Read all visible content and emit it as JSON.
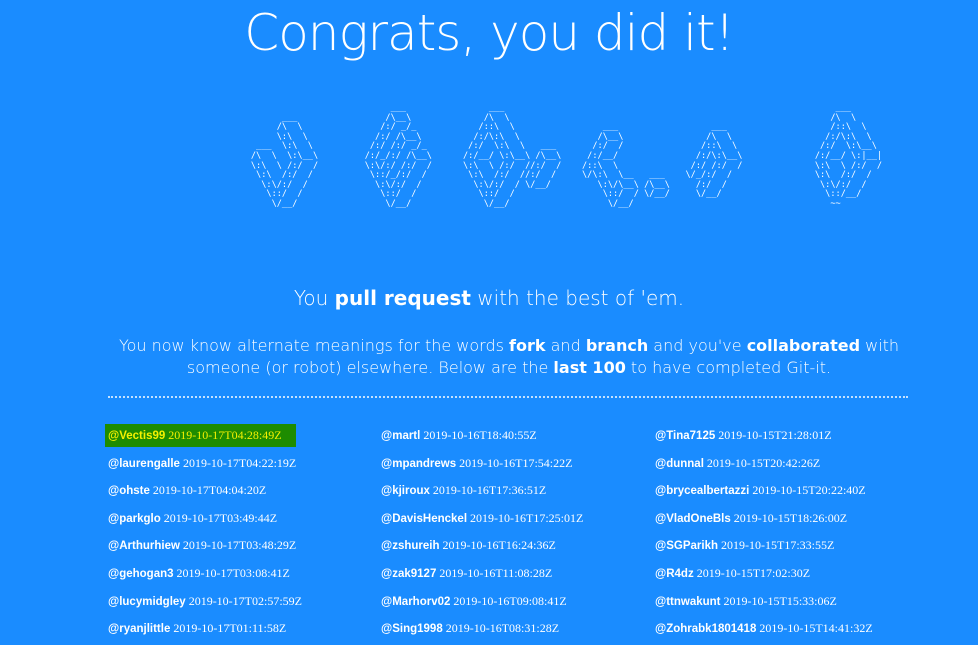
{
  "header": {
    "title": "Congrats, you did it!"
  },
  "ascii_art": "                                ___                ___                                                                ___\n           ___                 /\\__\\              /\\  \\                                                              /\\  \\\n          /\\  \\               /:/ _/_            /::\\  \\                 ___                  ___                    /::\\  \\\n          \\:\\  \\             /:/ /\\__\\          /:/\\:\\  \\               /\\__\\                /\\  \\                  /:/\\:\\  \\\n      ___  \\:\\  \\           /:/ /:/ _/_        /:/  \\:\\  \\   ___       /:/  /               /::\\  \\                /:/  \\:\\__\\\n     /\\  \\  \\:\\__\\         /:/_/:/ /\\__\\      /:/__/ \\:\\__\\ /\\__\\     /:/__/               /:/\\:\\__\\              /:/__/ \\:|__|\n     \\:\\  \\ /:/  /         \\:\\/:/ /:/  /      \\:\\  \\ /:/  //:/  /    /::\\  \\              /:/ /:/  /              \\:\\  \\ /:/  /\n      \\:\\  /:/  /           \\::/_/:/  /        \\:\\  /:/  //:/  /     \\/\\:\\  \\__   ___    \\/_/:/  /                \\:\\  /:/  /\n       \\:\\/:/  /             \\:\\/:/  /          \\:\\/:/  / \\/__/         \\:\\/\\__\\ /\\__\\     /:/  /                  \\:\\/:/  /\n        \\::/  /               \\::/  /            \\::/  /                 \\::/  / \\/__/     \\/__/                    \\::/__/\n         \\/__/                 \\/__/              \\/__/                   \\/__/                                      ~~",
  "tagline": {
    "before": "You ",
    "bold": "pull request",
    "after": " with the best of 'em."
  },
  "description": {
    "t1": "You now know alternate meanings for the words ",
    "b1": "fork",
    "t2": " and ",
    "b2": "branch",
    "t3": " and you've ",
    "b3": "collaborated",
    "t4": " with someone (or robot) elsewhere. Below are the ",
    "b4": "last 100",
    "t5": " to have completed Git-it."
  },
  "completions": {
    "col1": [
      {
        "user": "@Vectis99",
        "time": "2019-10-17T04:28:49Z"
      },
      {
        "user": "@laurengalle",
        "time": "2019-10-17T04:22:19Z"
      },
      {
        "user": "@ohste",
        "time": "2019-10-17T04:04:20Z"
      },
      {
        "user": "@parkglo",
        "time": "2019-10-17T03:49:44Z"
      },
      {
        "user": "@Arthurhiew",
        "time": "2019-10-17T03:48:29Z"
      },
      {
        "user": "@gehogan3",
        "time": "2019-10-17T03:08:41Z"
      },
      {
        "user": "@lucymidgley",
        "time": "2019-10-17T02:57:59Z"
      },
      {
        "user": "@ryanjlittle",
        "time": "2019-10-17T01:11:58Z"
      }
    ],
    "col2": [
      {
        "user": "@martl",
        "time": "2019-10-16T18:40:55Z"
      },
      {
        "user": "@mpandrews",
        "time": "2019-10-16T17:54:22Z"
      },
      {
        "user": "@kjiroux",
        "time": "2019-10-16T17:36:51Z"
      },
      {
        "user": "@DavisHenckel",
        "time": "2019-10-16T17:25:01Z"
      },
      {
        "user": "@zshureih",
        "time": "2019-10-16T16:24:36Z"
      },
      {
        "user": "@zak9127",
        "time": "2019-10-16T11:08:28Z"
      },
      {
        "user": "@Marhorv02",
        "time": "2019-10-16T09:08:41Z"
      },
      {
        "user": "@Sing1998",
        "time": "2019-10-16T08:31:28Z"
      }
    ],
    "col3": [
      {
        "user": "@Tina7125",
        "time": "2019-10-15T21:28:01Z"
      },
      {
        "user": "@dunnal",
        "time": "2019-10-15T20:42:26Z"
      },
      {
        "user": "@brycealbertazzi",
        "time": "2019-10-15T20:22:40Z"
      },
      {
        "user": "@VladOneBls",
        "time": "2019-10-15T18:26:00Z"
      },
      {
        "user": "@SGParikh",
        "time": "2019-10-15T17:33:55Z"
      },
      {
        "user": "@R4dz",
        "time": "2019-10-15T17:02:30Z"
      },
      {
        "user": "@ttnwakunt",
        "time": "2019-10-15T15:33:06Z"
      },
      {
        "user": "@Zohrabk1801418",
        "time": "2019-10-15T14:41:32Z"
      }
    ]
  },
  "colors": {
    "background": "#1a8cff",
    "highlight_bg": "#1e8c00",
    "highlight_text": "#f4f000"
  }
}
